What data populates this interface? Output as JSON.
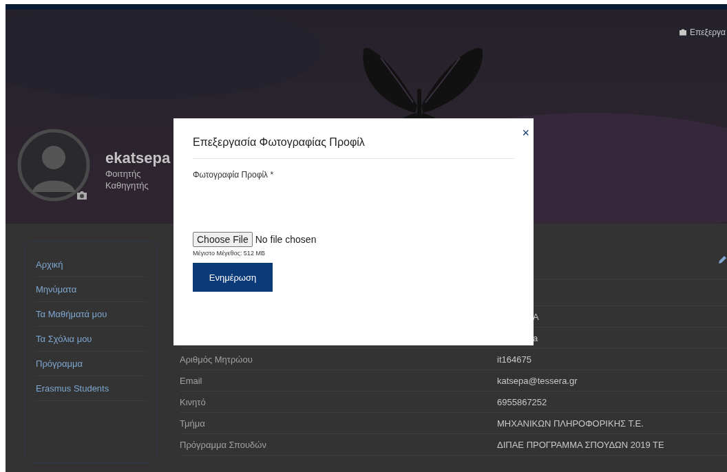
{
  "cover": {
    "edit_label": "Επεξεργα"
  },
  "profile": {
    "username": "ekatsepa",
    "roles": [
      "Φοιτητής",
      "Καθηγητής"
    ]
  },
  "sidebar": {
    "items": [
      {
        "label": "Αρχική"
      },
      {
        "label": "Μηνύματα"
      },
      {
        "label": "Τα Μαθήματά μου"
      },
      {
        "label": "Τα Σχόλια μου"
      },
      {
        "label": "Πρόγραμμα"
      },
      {
        "label": "Erasmus Students"
      }
    ]
  },
  "details": {
    "rows": [
      {
        "kind": "clipped",
        "value": "A"
      },
      {
        "kind": "clipped",
        "value": "a"
      },
      {
        "kind": "full",
        "label": "Αριθμός Μητρώου",
        "value": "it164675"
      },
      {
        "kind": "full",
        "label": "Email",
        "value": "katsepa@tessera.gr"
      },
      {
        "kind": "full",
        "label": "Κινητό",
        "value": "6955867252"
      },
      {
        "kind": "full",
        "label": "Τμήμα",
        "value": "ΜΗΧΑΝΙΚΩΝ ΠΛΗΡΟΦΟΡΙΚΗΣ Τ.Ε."
      },
      {
        "kind": "full",
        "label": "Πρόγραμμα Σπουδών",
        "value": "ΔΙΠΑΕ ΠΡΟΓΡΑΜΜΑ ΣΠΟΥΔΩΝ 2019 ΤΕ"
      }
    ]
  },
  "modal": {
    "title": "Επεξεργασία Φωτογραφίας Προφίλ",
    "close": "×",
    "field_label": "Φωτογραφία Προφίλ *",
    "file_button": "Choose File",
    "file_status": "No file chosen",
    "hint": "Μέγιστο Μέγεθος: 512 MB",
    "submit": "Ενημέρωση"
  }
}
